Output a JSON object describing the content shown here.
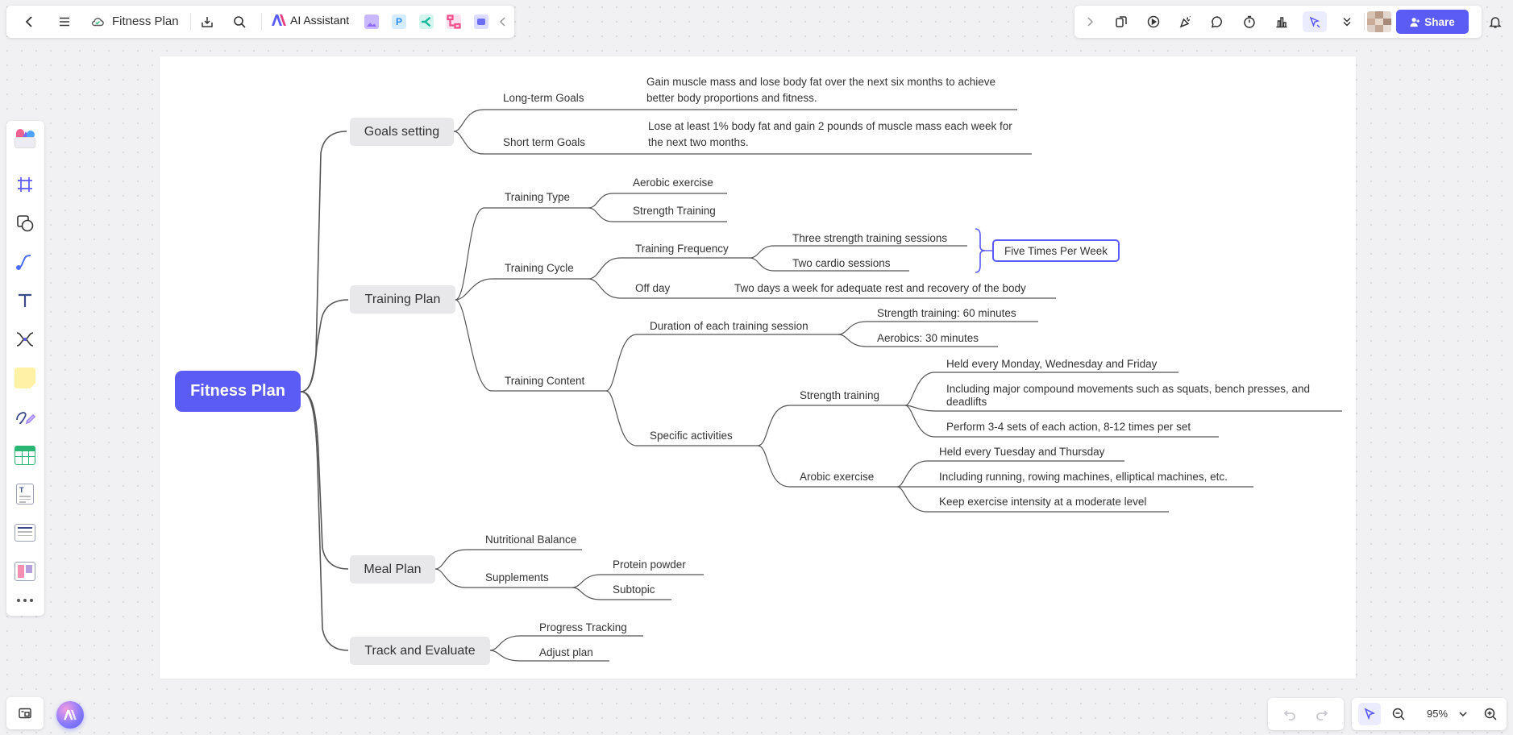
{
  "header": {
    "doc_title": "Fitness Plan",
    "ai_label": "AI Assistant",
    "share_label": "Share"
  },
  "zoom": "95%",
  "colors": {
    "accent": "#5b5bf5",
    "node_bg": "#e8e8ea",
    "line": "#555555"
  },
  "mindmap": {
    "root": "Fitness Plan",
    "goals": {
      "label": "Goals setting",
      "long_term": {
        "label": "Long-term Goals",
        "text1": "Gain muscle mass and lose body fat over the next six months to achieve",
        "text2": "better body proportions and fitness."
      },
      "short_term": {
        "label": "Short term Goals",
        "text1": "Lose at least 1% body fat and gain 2 pounds of muscle mass each week for",
        "text2": "the next two months."
      }
    },
    "training": {
      "label": "Training Plan",
      "type": {
        "label": "Training Type",
        "aerobic": "Aerobic exercise",
        "strength": "Strength Training"
      },
      "cycle": {
        "label": "Training Cycle",
        "frequency": {
          "label": "Training Frequency",
          "strength_sessions": "Three strength training sessions",
          "cardio_sessions": "Two cardio sessions",
          "summary": "Five Times Per Week"
        },
        "off_day": {
          "label": "Off day",
          "text": "Two days a week for adequate rest and recovery of the body"
        }
      },
      "content": {
        "label": "Training Content",
        "duration": {
          "label": "Duration of each training session",
          "strength": "Strength training: 60 minutes",
          "aerobics": "Aerobics: 30 minutes"
        },
        "activities": {
          "label": "Specific activities",
          "strength": {
            "label": "Strength training",
            "item1": "Held every Monday, Wednesday and Friday",
            "item2a": "Including major compound movements such as squats, bench presses, and",
            "item2b": "deadlifts",
            "item3": "Perform 3-4 sets of each action, 8-12 times per set"
          },
          "arobic": {
            "label": "Arobic exercise",
            "item1": "Held every Tuesday and Thursday",
            "item2": "Including running, rowing machines, elliptical machines, etc.",
            "item3": "Keep exercise intensity at a moderate level"
          }
        }
      }
    },
    "meal": {
      "label": "Meal Plan",
      "nutritional": "Nutritional Balance",
      "supplements": {
        "label": "Supplements",
        "protein": "Protein powder",
        "subtopic": "Subtopic"
      }
    },
    "track": {
      "label": "Track and Evaluate",
      "progress": "Progress Tracking",
      "adjust": "Adjust plan"
    }
  }
}
